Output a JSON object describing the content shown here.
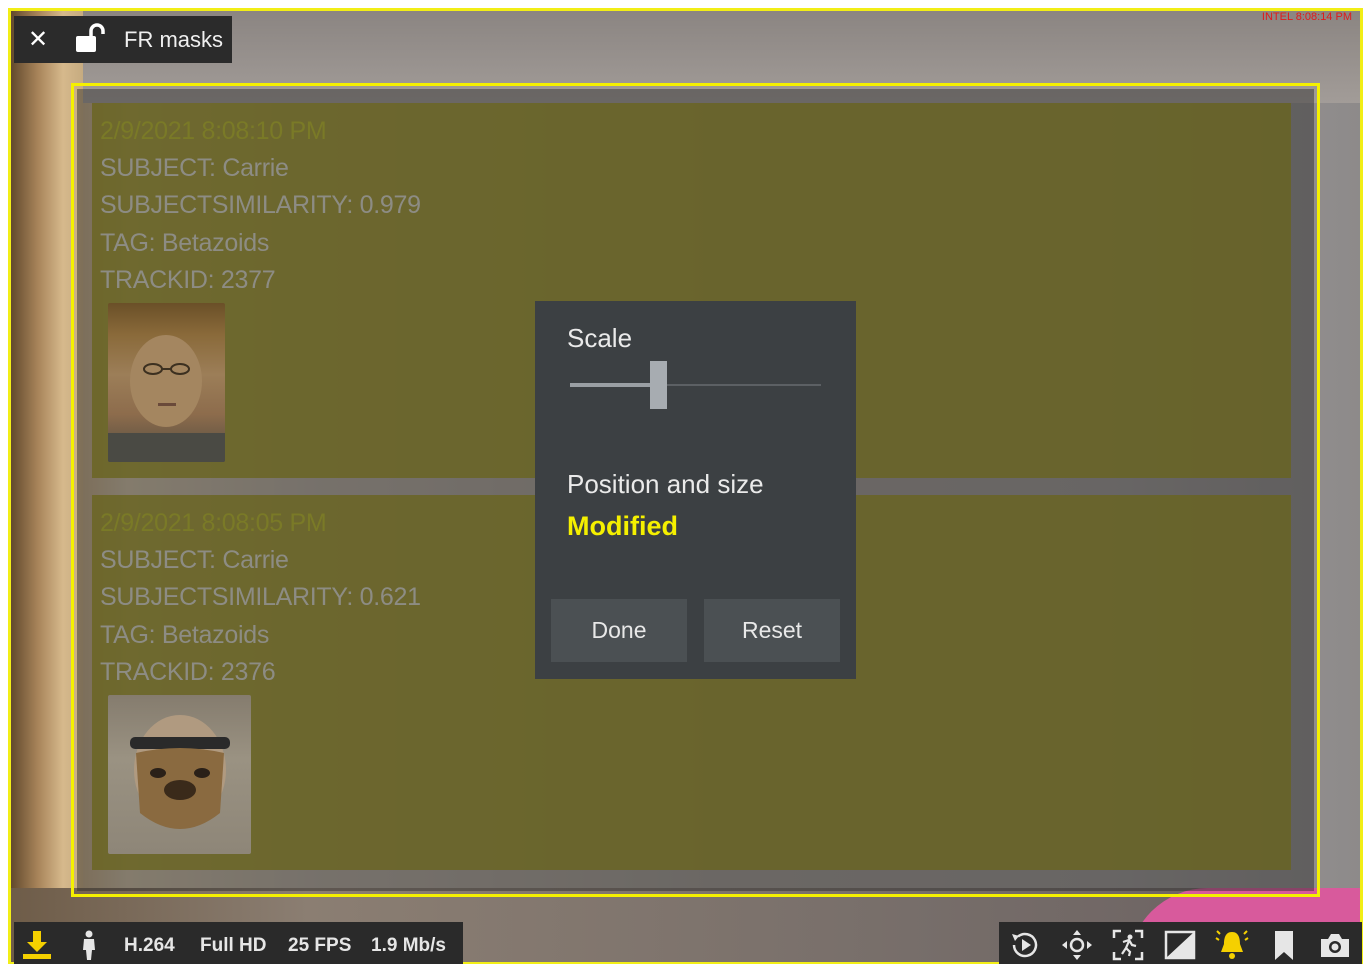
{
  "camera": {
    "title": "FR masks",
    "timestamp": "INTEL 8:08:14 PM"
  },
  "detections": [
    {
      "timestamp": "2/9/2021 8:08:10 PM",
      "subject": "SUBJECT: Carrie",
      "similarity": "SUBJECTSIMILARITY: 0.979",
      "tag": "TAG: Betazoids",
      "trackid": "TRACKID: 2377"
    },
    {
      "timestamp": "2/9/2021 8:08:05 PM",
      "subject": "SUBJECT: Carrie",
      "similarity": "SUBJECTSIMILARITY: 0.621",
      "tag": "TAG: Betazoids",
      "trackid": "TRACKID: 2376"
    }
  ],
  "dialog": {
    "scale_label": "Scale",
    "scale_value": 0.33,
    "position_label": "Position and size",
    "status": "Modified",
    "done_label": "Done",
    "reset_label": "Reset"
  },
  "status_bar": {
    "codec": "H.264",
    "resolution": "Full HD",
    "fps": "25 FPS",
    "bitrate": "1.9 Mb/s"
  },
  "icons": {
    "close": "close-icon",
    "lock": "unlocked-padlock-icon",
    "download": "download-icon",
    "person": "person-icon",
    "playback": "playback-icon",
    "ptz": "ptz-icon",
    "motion": "motion-detection-icon",
    "privacy": "privacy-mask-icon",
    "alarm": "alarm-bell-icon",
    "bookmark": "bookmark-icon",
    "snapshot": "camera-icon"
  },
  "colors": {
    "highlight": "#f5f000",
    "overlay_text": "#8d8c84",
    "dialog_bg": "#3c4043",
    "timestamp_red": "#e01a1a",
    "alarm_yellow": "#f5d000"
  }
}
